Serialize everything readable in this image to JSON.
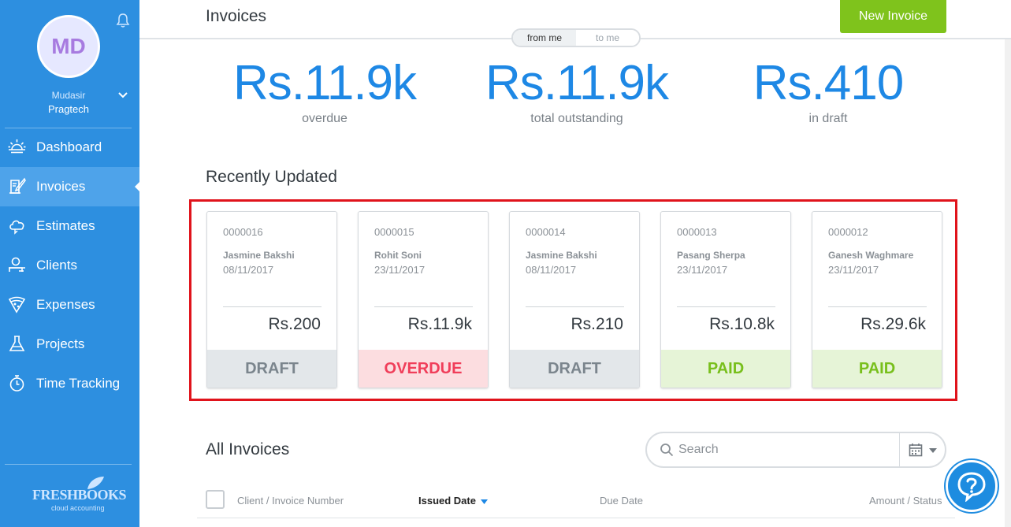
{
  "sidebar": {
    "user": {
      "initials": "MD",
      "name": "Mudasir",
      "org": "Pragtech"
    },
    "nav": [
      {
        "label": "Dashboard",
        "icon": "sunrise-icon",
        "active": false
      },
      {
        "label": "Invoices",
        "icon": "invoice-quill-icon",
        "active": true
      },
      {
        "label": "Estimates",
        "icon": "cloud-estimate-icon",
        "active": false
      },
      {
        "label": "Clients",
        "icon": "client-desk-icon",
        "active": false
      },
      {
        "label": "Expenses",
        "icon": "pizza-slice-icon",
        "active": false
      },
      {
        "label": "Projects",
        "icon": "flask-icon",
        "active": false
      },
      {
        "label": "Time Tracking",
        "icon": "stopwatch-icon",
        "active": false
      }
    ],
    "logo": {
      "main": "FRESHBOOKS",
      "sub": "cloud accounting"
    }
  },
  "header": {
    "title": "Invoices",
    "new_invoice_label": "New Invoice",
    "toggle": {
      "from_me": "from me",
      "to_me": "to me",
      "selected": "from me"
    }
  },
  "stats": [
    {
      "value": "Rs.11.9k",
      "label": "overdue"
    },
    {
      "value": "Rs.11.9k",
      "label": "total outstanding"
    },
    {
      "value": "Rs.410",
      "label": "in draft"
    }
  ],
  "recent": {
    "title": "Recently Updated",
    "cards": [
      {
        "number": "0000016",
        "client": "Jasmine Bakshi",
        "date": "08/11/2017",
        "amount": "Rs.200",
        "status": "DRAFT"
      },
      {
        "number": "0000015",
        "client": "Rohit Soni",
        "date": "23/11/2017",
        "amount": "Rs.11.9k",
        "status": "OVERDUE"
      },
      {
        "number": "0000014",
        "client": "Jasmine Bakshi",
        "date": "08/11/2017",
        "amount": "Rs.210",
        "status": "DRAFT"
      },
      {
        "number": "0000013",
        "client": "Pasang Sherpa",
        "date": "23/11/2017",
        "amount": "Rs.10.8k",
        "status": "PAID"
      },
      {
        "number": "0000012",
        "client": "Ganesh Waghmare",
        "date": "23/11/2017",
        "amount": "Rs.29.6k",
        "status": "PAID"
      }
    ]
  },
  "all_invoices": {
    "title": "All Invoices",
    "search_placeholder": "Search",
    "columns": {
      "client": "Client / Invoice Number",
      "issued": "Issued Date",
      "due": "Due Date",
      "amount": "Amount / Status"
    }
  },
  "colors": {
    "sidebar": "#2d8fe0",
    "accent_blue": "#1e88e5",
    "new_invoice_green": "#7fc31c",
    "highlight_red": "#e0131b",
    "overdue": "#f03e5a",
    "paid": "#78bf1c",
    "draft": "#7b858d"
  }
}
